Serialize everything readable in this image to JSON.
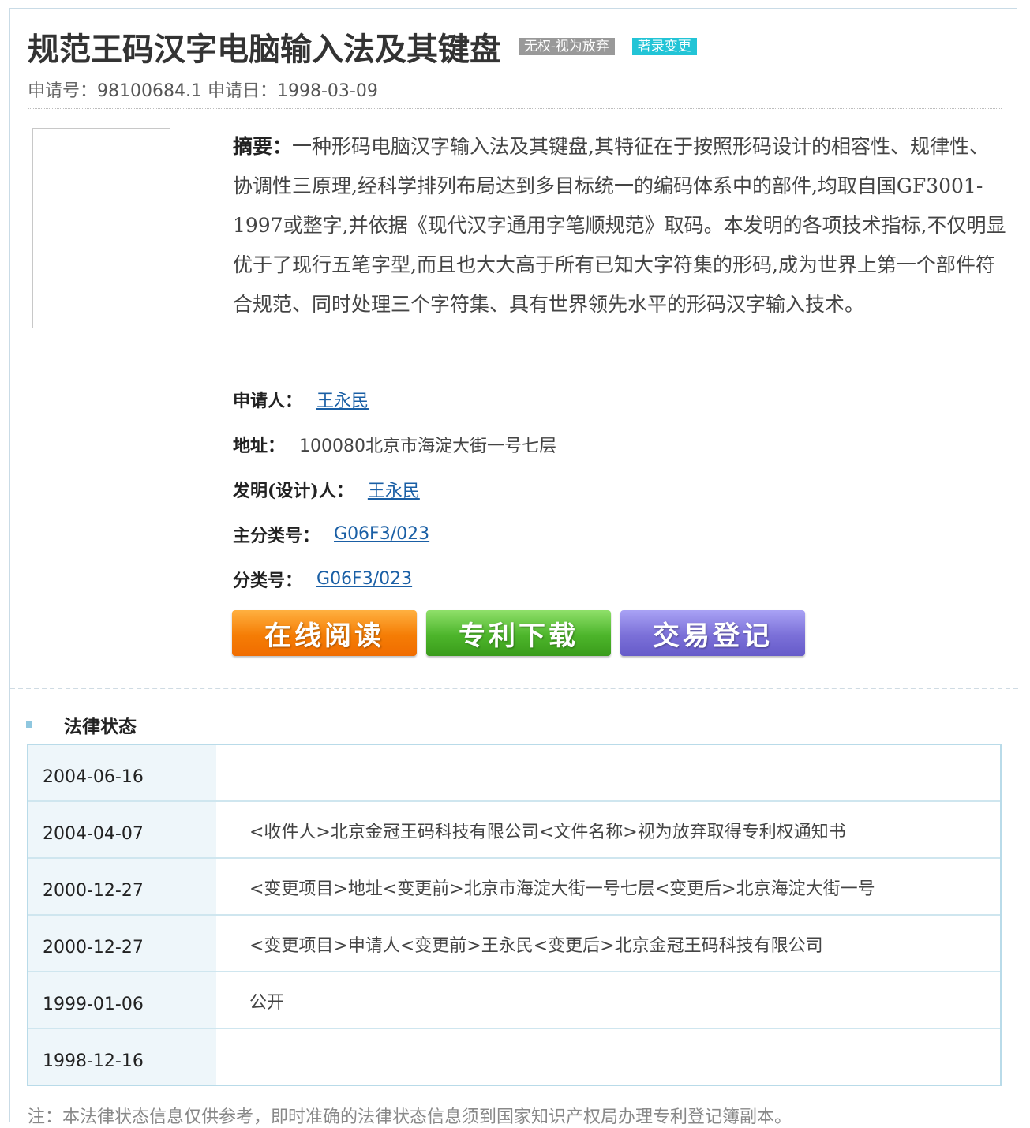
{
  "patent": {
    "title": "规范王码汉字电脑输入法及其键盘",
    "badges": [
      "无权-视为放弃",
      "著录变更"
    ],
    "application_no_label": "申请号：",
    "application_no": "98100684.1",
    "application_date_label": "申请日：",
    "application_date": "1998-03-09"
  },
  "abstract": {
    "label": "摘要：",
    "text": "一种形码电脑汉字输入法及其键盘,其特征在于按照形码设计的相容性、规律性、协调性三原理,经科学排列布局达到多目标统一的编码体系中的部件,均取自国GF3001-1997或整字,并依据《现代汉字通用字笔顺规范》取码。本发明的各项技术指标,不仅明显优于了现行五笔字型,而且也大大高于所有已知大字符集的形码,成为世界上第一个部件符合规范、同时处理三个字符集、具有世界领先水平的形码汉字输入技术。"
  },
  "fields": {
    "applicant_label": "申请人：",
    "applicant": "王永民",
    "address_label": "地址：",
    "address": "100080北京市海淀大街一号七层",
    "inventor_label": "发明(设计)人：",
    "inventor": "王永民",
    "main_class_label": "主分类号：",
    "main_class": "G06F3/023",
    "class_label": "分类号：",
    "class": "G06F3/023"
  },
  "buttons": {
    "read": "在线阅读",
    "download": "专利下载",
    "trade": "交易登记"
  },
  "legal": {
    "heading": "法律状态",
    "rows": [
      {
        "date": "2004-06-16",
        "desc": ""
      },
      {
        "date": "2004-04-07",
        "desc": "<收件人>北京金冠王码科技有限公司<文件名称>视为放弃取得专利权通知书"
      },
      {
        "date": "2000-12-27",
        "desc": "<变更项目>地址<变更前>北京市海淀大街一号七层<变更后>北京海淀大街一号"
      },
      {
        "date": "2000-12-27",
        "desc": "<变更项目>申请人<变更前>王永民<变更后>北京金冠王码科技有限公司"
      },
      {
        "date": "1999-01-06",
        "desc": "公开"
      },
      {
        "date": "1998-12-16",
        "desc": ""
      }
    ],
    "note": "注：本法律状态信息仅供参考，即时准确的法律状态信息须到国家知识产权局办理专利登记簿副本。"
  },
  "colors": {
    "badge_gray": "#999999",
    "badge_cyan": "#22c4d6",
    "link": "#1a5fa5",
    "date_cell_bg": "#eef6fa",
    "table_border": "#b9dbe9"
  }
}
